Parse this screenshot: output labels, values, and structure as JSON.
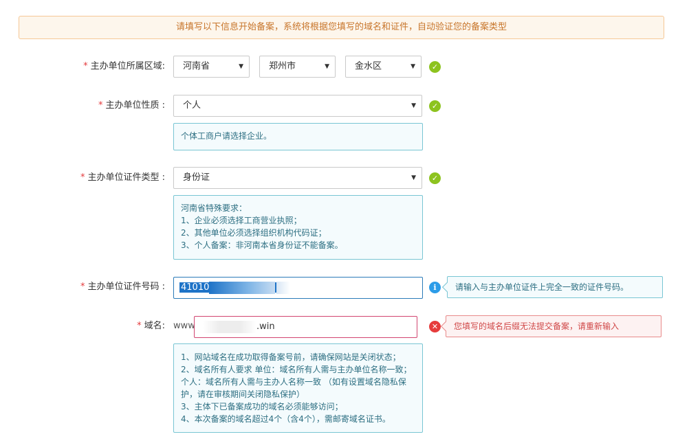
{
  "notice": "请填写以下信息开始备案，系统将根据您填写的域名和证件，自动验证您的备案类型",
  "required_mark": "*",
  "region": {
    "label": "主办单位所属区域:",
    "province": "河南省",
    "city": "郑州市",
    "district": "金水区"
  },
  "nature": {
    "label": "主办单位性质 :",
    "value": "个人",
    "hint": "个体工商户请选择企业。"
  },
  "cert_type": {
    "label": "主办单位证件类型 :",
    "value": "身份证",
    "hint_lines": [
      "河南省特殊要求：",
      "1、企业必须选择工商营业执照；",
      "2、其他单位必须选择组织机构代码证；",
      "3、个人备案：非河南本省身份证不能备案。"
    ]
  },
  "cert_number": {
    "label": "主办单位证件号码 :",
    "value_visible": "41010",
    "tip": "请输入与主办单位证件上完全一致的证件号码。"
  },
  "domain": {
    "label": "域名:",
    "prefix": "www.",
    "suffix": ".win",
    "error": "您填写的域名后缀无法提交备案，请重新输入",
    "hint_lines": [
      "1、网站域名在成功取得备案号前，请确保网站是关闭状态；",
      "2、域名所有人要求 单位：域名所有人需与主办单位名称一致；",
      "个人：域名所有人需与主办人名称一致 （如有设置域名隐私保",
      "护，请在审核期间关闭隐私保护）",
      "3、主体下已备案成功的域名必须能够访问；",
      "4、本次备案的域名超过4个（含4个），需邮寄域名证书。"
    ]
  },
  "icons": {
    "arrow": "▼",
    "check": "✓",
    "info": "i",
    "error": "✕"
  },
  "colors": {
    "accent_green": "#8dc31f",
    "info_blue": "#2c9ce8",
    "error_red": "#e63c3c",
    "notice_orange": "#c8752a"
  }
}
